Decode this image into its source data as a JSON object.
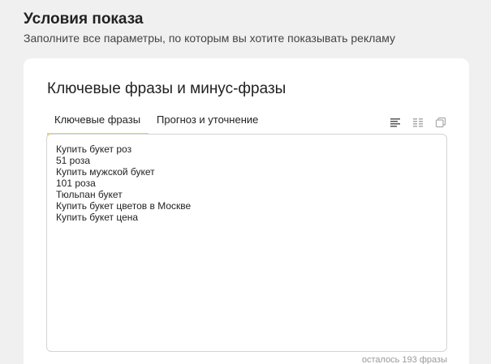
{
  "header": {
    "title": "Условия показа",
    "subtitle": "Заполните все параметры, по которым вы хотите показывать рекламу"
  },
  "card": {
    "title": "Ключевые фразы и минус-фразы",
    "tabs": [
      {
        "label": "Ключевые фразы",
        "active": true
      },
      {
        "label": "Прогноз и уточнение",
        "active": false
      }
    ],
    "view_icons": [
      "list-view-icon",
      "table-view-icon",
      "copy-icon"
    ],
    "phrases": [
      "Купить букет роз",
      "51 роза",
      "Купить мужской букет",
      "101 роза",
      "Тюльпан букет",
      "Купить букет цветов в Москве",
      "Купить букет цена"
    ],
    "counter": "осталось 193 фразы"
  },
  "colors": {
    "accent": "#fed42b",
    "background": "#f0f0f0",
    "card": "#ffffff",
    "border": "#d4d4d4"
  }
}
